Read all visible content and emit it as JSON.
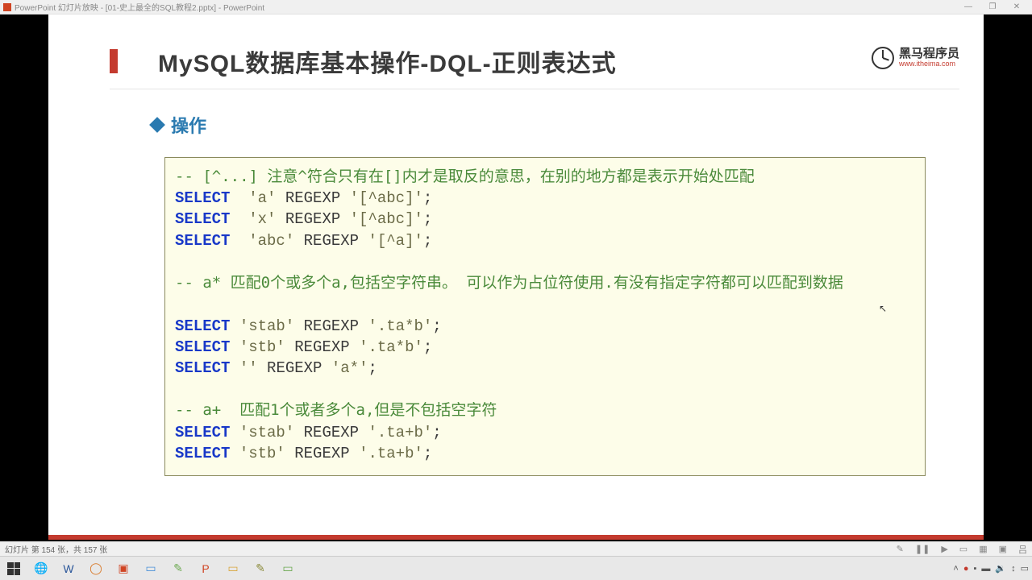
{
  "titlebar": {
    "text": "PowerPoint 幻灯片放映 - [01-史上最全的SQL教程2.pptx] - PowerPoint"
  },
  "slide": {
    "title": "MySQL数据库基本操作-DQL-正则表达式",
    "subtitle": "操作"
  },
  "brand": {
    "cn": "黑马程序员",
    "url": "www.itheima.com"
  },
  "code": {
    "c1": "-- [^...] 注意^符合只有在[]内才是取反的意思，在别的地方都是表示开始处匹配",
    "kw": "SELECT",
    "l2a": "  'a'",
    "l2b": " REGEXP ",
    "l2c": "'[^abc]'",
    "l2d": ";",
    "l3a": "  'x'",
    "l3c": "'[^abc]'",
    "l4a": "  'abc'",
    "l4c": "'[^a]'",
    "c2": "-- a* 匹配0个或多个a,包括空字符串。 可以作为占位符使用.有没有指定字符都可以匹配到数据",
    "l5a": " 'stab'",
    "l5c": "'.ta*b'",
    "l6a": " 'stb'",
    "l6c": "'.ta*b'",
    "l7a": " ''",
    "l7c": "'a*'",
    "c3": "-- a+  匹配1个或者多个a,但是不包括空字符",
    "l8a": " 'stab'",
    "l8c": "'.ta+b'",
    "l9a": " 'stb'",
    "l9c": "'.ta+b'"
  },
  "statusbar": {
    "slidecount": "幻灯片 第 154 张，共 157 张"
  }
}
